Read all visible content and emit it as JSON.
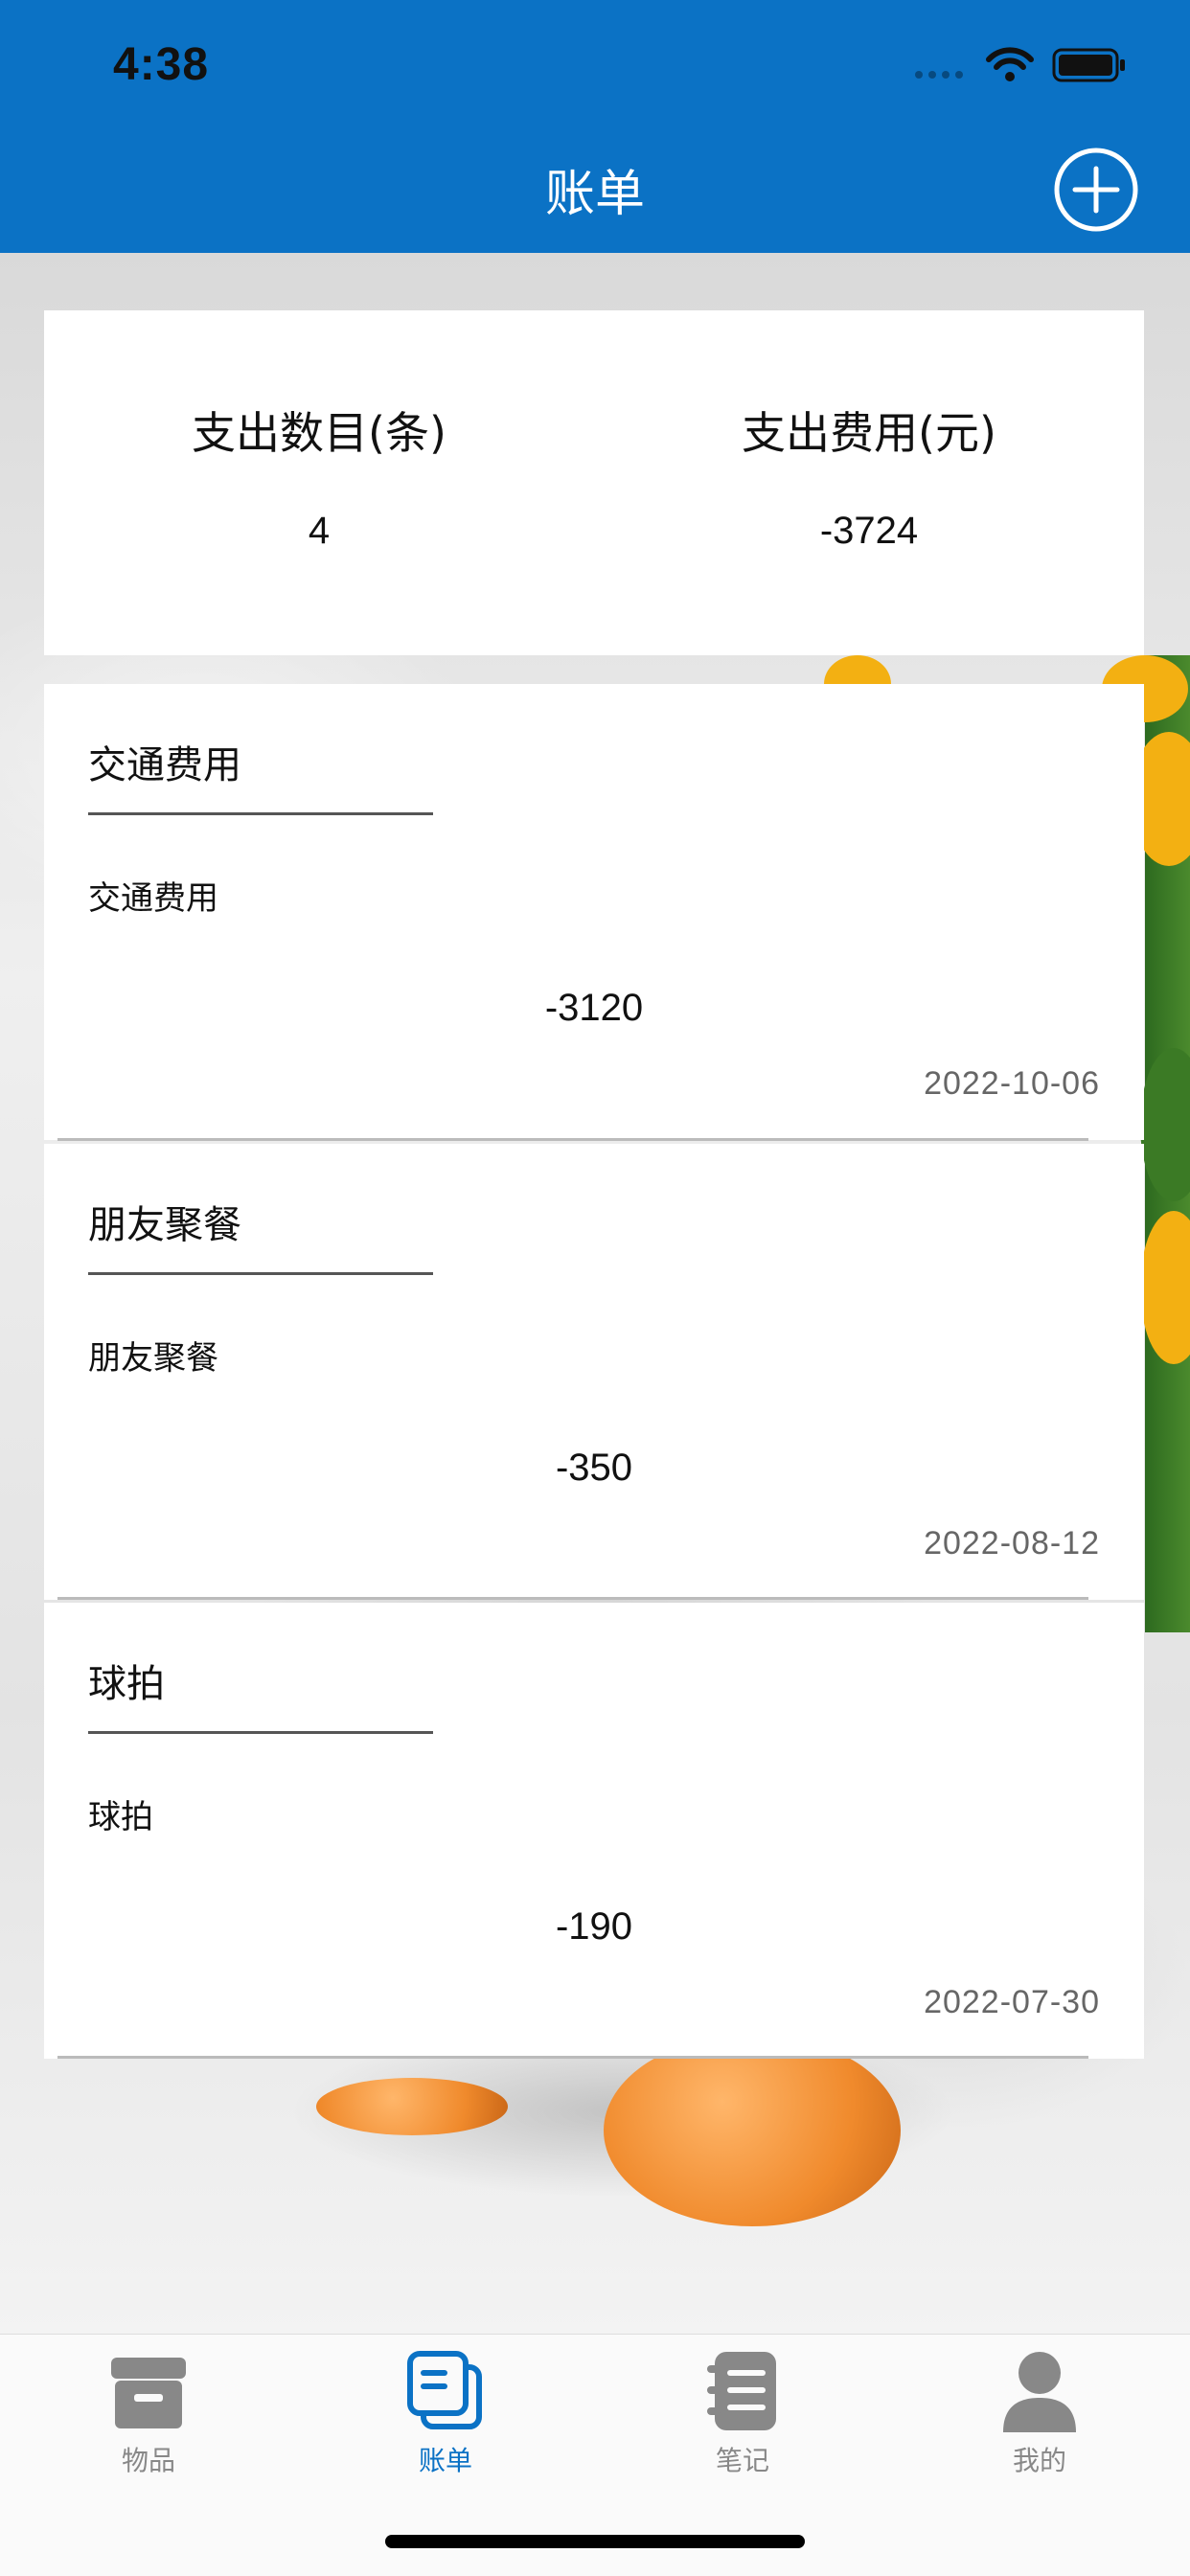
{
  "status_bar": {
    "time": "4:38"
  },
  "nav": {
    "title": "账单",
    "add_icon": "plus-circle-icon"
  },
  "summary": {
    "count_label": "支出数目(条)",
    "count_value": "4",
    "amount_label": "支出费用(元)",
    "amount_value": "-3724"
  },
  "bills": [
    {
      "title": "交通费用",
      "desc": "交通费用",
      "amount": "-3120",
      "date": "2022-10-06"
    },
    {
      "title": "朋友聚餐",
      "desc": "朋友聚餐",
      "amount": "-350",
      "date": "2022-08-12"
    },
    {
      "title": "球拍",
      "desc": "球拍",
      "amount": "-190",
      "date": "2022-07-30"
    }
  ],
  "tabs": [
    {
      "label": "物品",
      "icon": "box-icon",
      "active": false
    },
    {
      "label": "账单",
      "icon": "bill-icon",
      "active": true
    },
    {
      "label": "笔记",
      "icon": "notebook-icon",
      "active": false
    },
    {
      "label": "我的",
      "icon": "user-icon",
      "active": false
    }
  ],
  "colors": {
    "primary": "#0B72C5",
    "tab_inactive": "#888888",
    "header_text": "#FFFFFF"
  }
}
